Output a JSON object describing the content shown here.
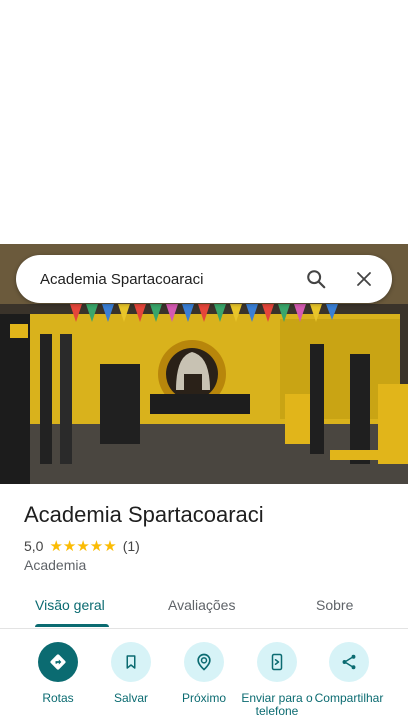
{
  "search": {
    "query": "Academia Spartacoaraci"
  },
  "place": {
    "name": "Academia Spartacoaraci",
    "rating": "5,0",
    "stars": "★★★★★",
    "review_count": "(1)",
    "category": "Academia"
  },
  "tabs": [
    {
      "label": "Visão geral",
      "active": true
    },
    {
      "label": "Avaliações",
      "active": false
    },
    {
      "label": "Sobre",
      "active": false
    }
  ],
  "actions": [
    {
      "label": "Rotas",
      "icon": "directions-icon"
    },
    {
      "label": "Salvar",
      "icon": "bookmark-icon"
    },
    {
      "label": "Próximo",
      "icon": "nearby-icon"
    },
    {
      "label": "Enviar para o telefone",
      "icon": "send-to-phone-icon"
    },
    {
      "label": "Compartilhar",
      "icon": "share-icon"
    }
  ],
  "colors": {
    "accent": "#0b6b71",
    "chip_bg": "#d7f3f7",
    "star": "#fbbc04"
  }
}
